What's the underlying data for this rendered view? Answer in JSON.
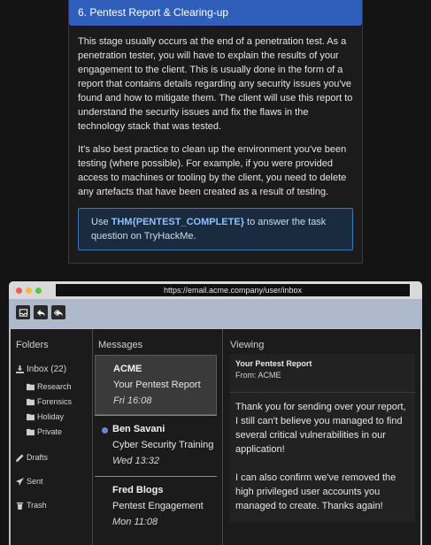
{
  "task": {
    "header": "6. Pentest Report & Clearing-up",
    "paragraph1": "This stage usually occurs at the end of a penetration test. As a penetration tester, you will have to explain the results of your engagement to the client. This is usually done in the form of a report that contains details regarding any security issues you've found and how to mitigate them. The client will use this report to understand the security issues and fix the flaws in the technology stack that was tested.",
    "paragraph2": "It's also best practice to clean up the environment you've been testing (where possible). For example, if you were provided access to machines or tooling by the client, you need to delete any artefacts that have been created as a result of testing.",
    "callout_prefix": "Use ",
    "callout_flag": "THM{PENTEST_COMPLETE}",
    "callout_suffix": " to answer the task question on TryHackMe."
  },
  "browser": {
    "url": "https://email.acme.company/user/inbox"
  },
  "mail": {
    "folders_title": "Folders",
    "inbox_label": "Inbox (22)",
    "subfolders": [
      "Research",
      "Forensics",
      "Holiday",
      "Private"
    ],
    "drafts_label": "Drafts",
    "sent_label": "Sent",
    "trash_label": "Trash",
    "messages_title": "Messages",
    "messages": [
      {
        "from": "ACME",
        "subject": "Your Pentest Report",
        "time": "Fri 16:08"
      },
      {
        "from": "Ben Savani",
        "subject": "Cyber Security Training",
        "time": "Wed 13:32"
      },
      {
        "from": "Fred Blogs",
        "subject": "Pentest Engagement",
        "time": "Mon 11:08"
      }
    ],
    "viewing_title": "Viewing",
    "viewing": {
      "subject": "Your Pentest Report",
      "from": "From: ACME",
      "body1": "Thank you for sending over your report, I still can't believe you managed to find several critical vulnerabilities in our application!",
      "body2": "I can also confirm we've removed the high privileged user accounts you managed to create. Thanks again!"
    }
  }
}
